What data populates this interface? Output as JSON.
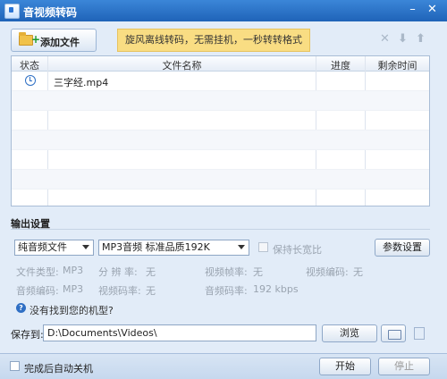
{
  "window": {
    "title": "音视频转码"
  },
  "toolbar": {
    "add_file_label": "添加文件",
    "promo_text": "旋风离线转码，无需挂机，一秒转转格式"
  },
  "table": {
    "headers": {
      "status": "状态",
      "filename": "文件名称",
      "progress": "进度",
      "remaining": "剩余时间"
    },
    "rows": [
      {
        "status_icon": "clock-icon",
        "filename": "三字经.mp4",
        "progress": "",
        "remaining": ""
      }
    ]
  },
  "output": {
    "section_title": "输出设置",
    "format_type": "纯音频文件",
    "format_preset": "MP3音频 标准品质192K",
    "keep_ratio_label": "保持长宽比",
    "params_button": "参数设置",
    "info": {
      "file_type_label": "文件类型:",
      "file_type_value": "MP3",
      "resolution_label": "分 辨 率:",
      "resolution_value": "无",
      "video_fps_label": "视频帧率:",
      "video_fps_value": "无",
      "video_codec_label": "视频编码:",
      "video_codec_value": "无",
      "audio_codec_label": "音频编码:",
      "audio_codec_value": "MP3",
      "video_bitrate_label": "视频码率:",
      "video_bitrate_value": "无",
      "audio_bitrate_label": "音频码率:",
      "audio_bitrate_value": "192 kbps"
    },
    "help_text": "没有找到您的机型?"
  },
  "save": {
    "label": "保存到:",
    "path": "D:\\Documents\\Videos\\",
    "browse_button": "浏览"
  },
  "bottom": {
    "shutdown_label": "完成后自动关机",
    "start_button": "开始",
    "stop_button": "停止"
  }
}
